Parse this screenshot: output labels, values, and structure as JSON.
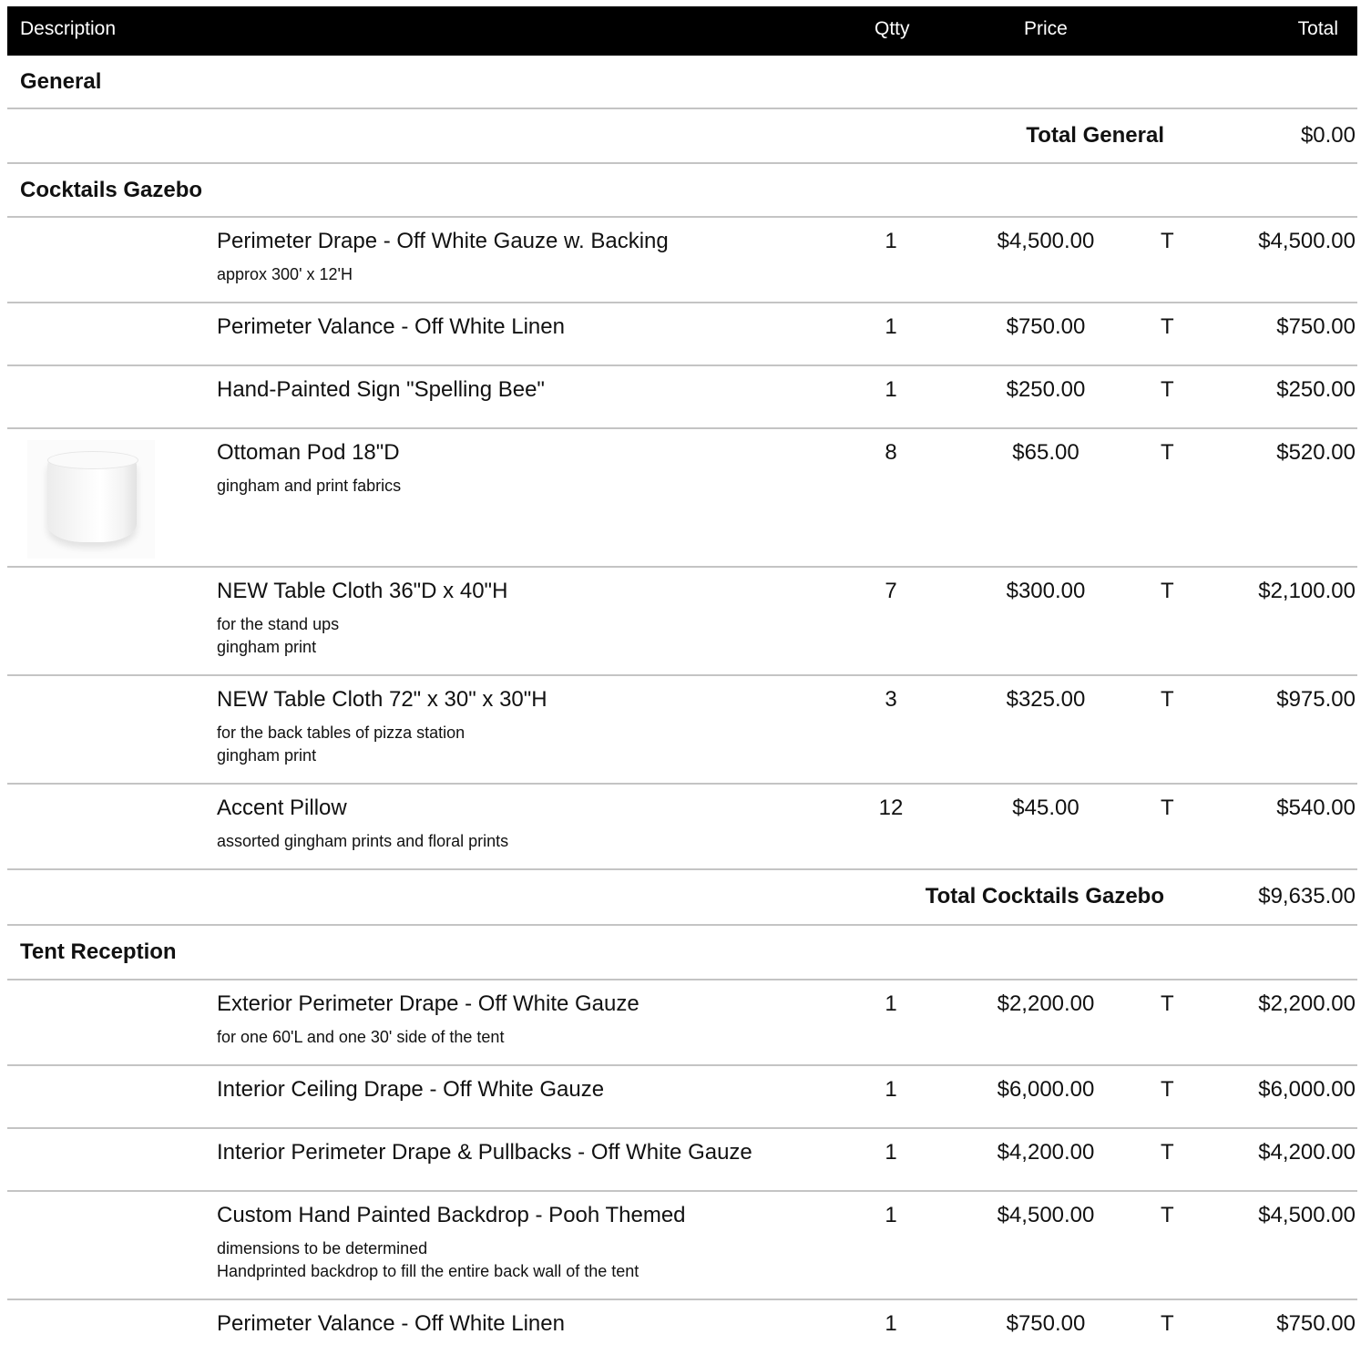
{
  "header": {
    "description": "Description",
    "qty": "Qtty",
    "price": "Price",
    "total": "Total"
  },
  "sections": [
    {
      "name": "General",
      "total_label": "Total General",
      "total_value": "$0.00"
    },
    {
      "name": "Cocktails Gazebo",
      "total_label": "Total Cocktails Gazebo",
      "total_value": "$9,635.00",
      "items": [
        {
          "name": "Perimeter Drape - Off White Gauze w. Backing",
          "notes": [
            "approx 300' x 12'H"
          ],
          "qty": "1",
          "price": "$4,500.00",
          "tax": "T",
          "total": "$4,500.00"
        },
        {
          "name": "Perimeter Valance - Off White Linen",
          "notes": [],
          "qty": "1",
          "price": "$750.00",
          "tax": "T",
          "total": "$750.00"
        },
        {
          "name": "Hand-Painted Sign \"Spelling Bee\"",
          "notes": [],
          "qty": "1",
          "price": "$250.00",
          "tax": "T",
          "total": "$250.00"
        },
        {
          "name": "Ottoman Pod 18\"D",
          "notes": [
            "gingham and print fabrics"
          ],
          "qty": "8",
          "price": "$65.00",
          "tax": "T",
          "total": "$520.00",
          "image": "ottoman-pod-photo"
        },
        {
          "name": "NEW Table Cloth 36\"D x 40\"H",
          "notes": [
            "for the stand ups",
            "gingham print"
          ],
          "qty": "7",
          "price": "$300.00",
          "tax": "T",
          "total": "$2,100.00"
        },
        {
          "name": "NEW Table Cloth 72\" x 30\" x 30\"H",
          "notes": [
            "for the back tables of pizza station",
            "gingham print"
          ],
          "qty": "3",
          "price": "$325.00",
          "tax": "T",
          "total": "$975.00"
        },
        {
          "name": "Accent Pillow",
          "notes": [
            "assorted gingham prints and floral prints"
          ],
          "qty": "12",
          "price": "$45.00",
          "tax": "T",
          "total": "$540.00"
        }
      ]
    },
    {
      "name": "Tent Reception",
      "items": [
        {
          "name": "Exterior Perimeter Drape - Off White Gauze",
          "notes": [
            "for one 60'L and one 30' side of the tent"
          ],
          "qty": "1",
          "price": "$2,200.00",
          "tax": "T",
          "total": "$2,200.00"
        },
        {
          "name": "Interior Ceiling Drape - Off White Gauze",
          "notes": [],
          "qty": "1",
          "price": "$6,000.00",
          "tax": "T",
          "total": "$6,000.00"
        },
        {
          "name": "Interior Perimeter Drape & Pullbacks - Off White Gauze",
          "notes": [],
          "qty": "1",
          "price": "$4,200.00",
          "tax": "T",
          "total": "$4,200.00"
        },
        {
          "name": "Custom Hand Painted Backdrop - Pooh Themed",
          "notes": [
            "dimensions to be determined",
            "Handprinted backdrop to fill the entire back wall of the tent"
          ],
          "qty": "1",
          "price": "$4,500.00",
          "tax": "T",
          "total": "$4,500.00"
        },
        {
          "name": "Perimeter Valance - Off White Linen",
          "notes": [],
          "qty": "1",
          "price": "$750.00",
          "tax": "T",
          "total": "$750.00"
        }
      ]
    }
  ]
}
